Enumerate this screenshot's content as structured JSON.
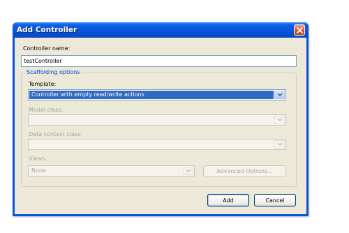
{
  "dialog": {
    "title": "Add Controller",
    "controller_name_label": "Controller name:",
    "controller_name_value": "testController",
    "scaffolding_label": "Scaffolding options",
    "template_label": "Template:",
    "template_value": "Controller with empty read/write actions",
    "model_class_label": "Model class:",
    "model_class_value": "",
    "data_context_label": "Data context class:",
    "data_context_value": "",
    "views_label": "Views:",
    "views_value": "None",
    "advanced_options_label": "Advanced Options...",
    "add_label": "Add",
    "cancel_label": "Cancel"
  },
  "colors": {
    "titlebar": "#0653d8",
    "client": "#ece9d8",
    "group_legend": "#0046d5",
    "selection": "#316ac5"
  },
  "icons": [
    "close-icon",
    "chevron-down-icon"
  ]
}
